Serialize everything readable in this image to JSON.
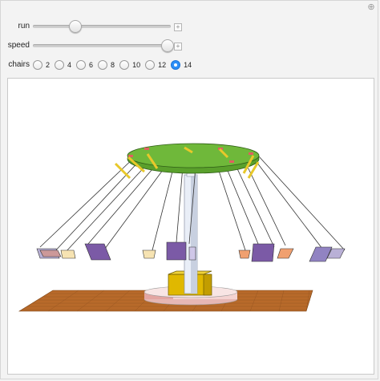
{
  "controls": {
    "run": {
      "label": "run",
      "value": 0.3
    },
    "speed": {
      "label": "speed",
      "value": 0.97
    },
    "chairs": {
      "label": "chairs",
      "options": [
        "2",
        "4",
        "6",
        "8",
        "10",
        "12",
        "14"
      ],
      "selected": "14"
    }
  },
  "icons": {
    "corner": "plus-icon",
    "slider_expand": "plus-icon"
  },
  "colors": {
    "canopy": "#5aa02c",
    "ground": "#b86a2a",
    "hub": "#e0b800",
    "base": "#f2c7c7",
    "radio_selected": "#2d8ff7",
    "chair_colors": [
      "#7b5aa6",
      "#f0a070",
      "#f6e3b2",
      "#b9b0d6"
    ]
  }
}
